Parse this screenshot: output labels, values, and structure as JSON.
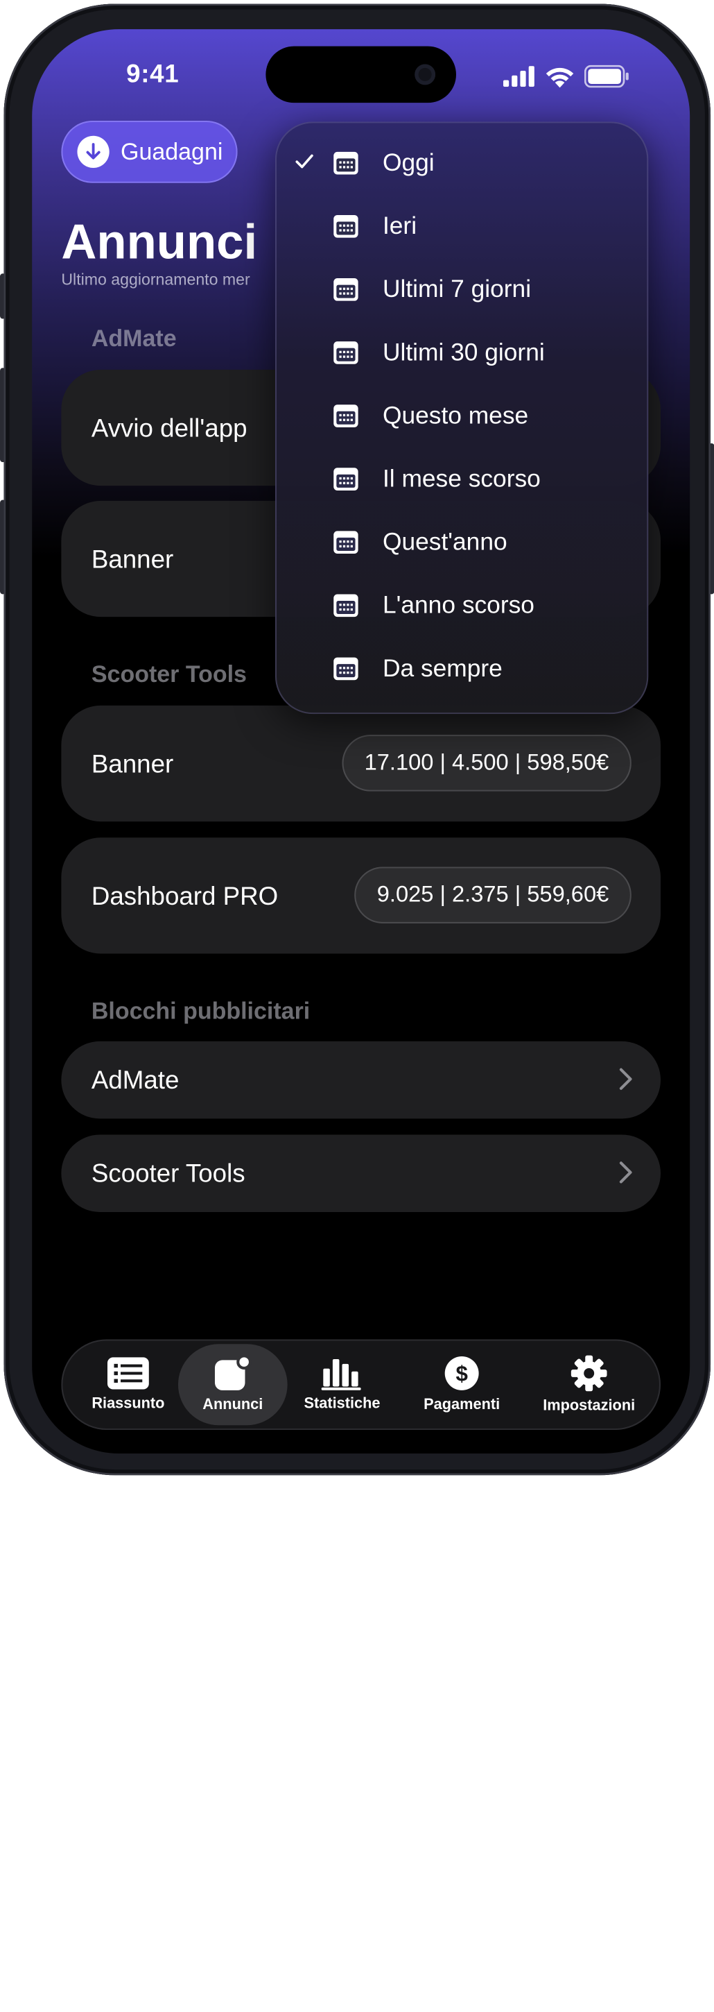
{
  "status_bar": {
    "time": "9:41"
  },
  "header": {
    "earnings_button": "Guadagni",
    "title": "Annunci",
    "subtitle": "Ultimo aggiornamento mer"
  },
  "sections": [
    {
      "title": "AdMate",
      "cards": [
        {
          "label": "Avvio dell'app",
          "chip": ""
        },
        {
          "label": "Banner",
          "chip": ""
        }
      ]
    },
    {
      "title": "Scooter Tools",
      "cards": [
        {
          "label": "Banner",
          "chip": "17.100 | 4.500 | 598,50€"
        },
        {
          "label": "Dashboard PRO",
          "chip": "9.025 | 2.375 | 559,60€"
        }
      ]
    },
    {
      "title": "Blocchi pubblicitari",
      "rows": [
        {
          "label": "AdMate"
        },
        {
          "label": "Scooter Tools"
        }
      ]
    }
  ],
  "date_menu": {
    "selected": "Oggi",
    "items": [
      "Oggi",
      "Ieri",
      "Ultimi 7 giorni",
      "Ultimi 30 giorni",
      "Questo mese",
      "Il mese scorso",
      "Quest'anno",
      "L'anno scorso",
      "Da sempre"
    ]
  },
  "tab_bar": {
    "active": "Annunci",
    "tabs": [
      {
        "label": "Riassunto",
        "icon": "list-icon"
      },
      {
        "label": "Annunci",
        "icon": "ads-icon"
      },
      {
        "label": "Statistiche",
        "icon": "bar-chart-icon"
      },
      {
        "label": "Pagamenti",
        "icon": "dollar-icon"
      },
      {
        "label": "Impostazioni",
        "icon": "gear-icon"
      }
    ]
  },
  "colors": {
    "accent": "#6756EC",
    "background": "#000000",
    "card": "#1F1F21"
  }
}
